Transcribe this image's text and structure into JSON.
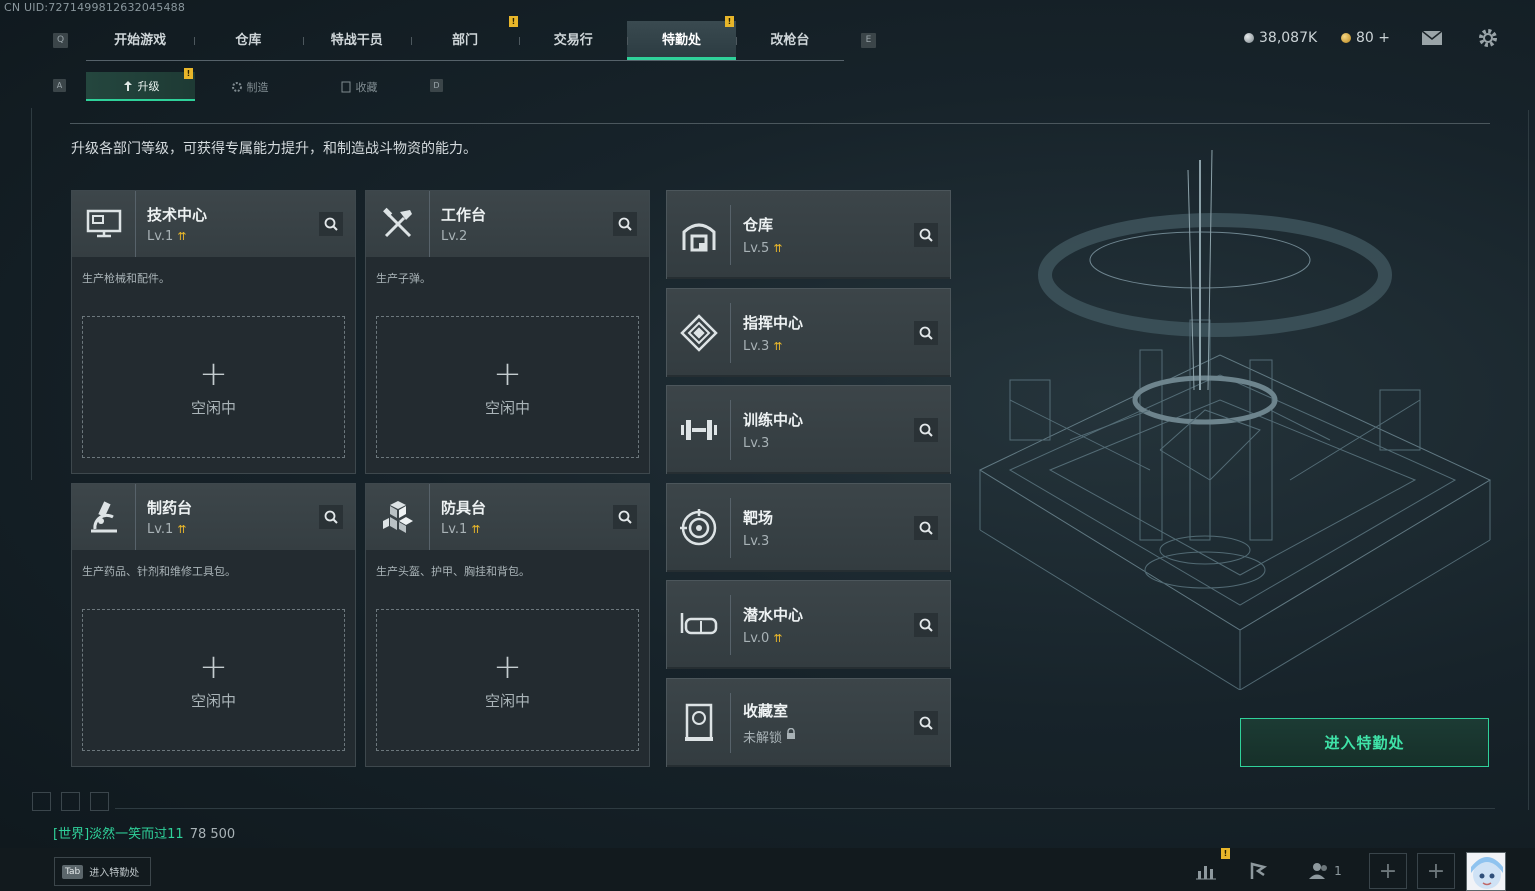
{
  "uid": "CN UID:7271499812632045488",
  "topnav": {
    "left_key": "Q",
    "right_key": "E",
    "tabs": [
      {
        "label": "开始游戏"
      },
      {
        "label": "仓库"
      },
      {
        "label": "特战干员"
      },
      {
        "label": "部门"
      },
      {
        "label": "交易行"
      },
      {
        "label": "特勤处"
      },
      {
        "label": "改枪台"
      }
    ],
    "active": "特勤处",
    "badge": "!"
  },
  "subnav": {
    "left_key": "A",
    "right_key": "D",
    "tabs": [
      {
        "label": "升级"
      },
      {
        "label": "制造"
      },
      {
        "label": "收藏"
      }
    ]
  },
  "currency": {
    "coins": "38,087K",
    "bonds": "80 +"
  },
  "intro": "升级各部门等级，可获得专属能力提升，和制造战斗物资的能力。",
  "stations": [
    {
      "name": "技术中心",
      "level": "Lv.1",
      "desc": "生产枪械和配件。",
      "slot_status": "空闲中",
      "icon": "monitor-icon"
    },
    {
      "name": "工作台",
      "level": "Lv.2",
      "desc": "生产子弹。",
      "slot_status": "空闲中",
      "icon": "tools-icon"
    },
    {
      "name": "制药台",
      "level": "Lv.1",
      "desc": "生产药品、针剂和维修工具包。",
      "slot_status": "空闲中",
      "icon": "microscope-icon"
    },
    {
      "name": "防具台",
      "level": "Lv.1",
      "desc": "生产头盔、护甲、胸挂和背包。",
      "slot_status": "空闲中",
      "icon": "cubes-icon"
    }
  ],
  "facilities": [
    {
      "name": "仓库",
      "level": "Lv.5",
      "icon": "warehouse-icon"
    },
    {
      "name": "指挥中心",
      "level": "Lv.3",
      "icon": "command-icon"
    },
    {
      "name": "训练中心",
      "level": "Lv.3",
      "icon": "dumbbell-icon"
    },
    {
      "name": "靶场",
      "level": "Lv.3",
      "icon": "target-icon"
    },
    {
      "name": "潜水中心",
      "level": "Lv.0",
      "icon": "diving-mask-icon"
    },
    {
      "name": "收藏室",
      "level": "未解锁",
      "icon": "collection-icon"
    }
  ],
  "enter_button": "进入特勤处",
  "chat": {
    "channel": "[世界]",
    "user": "淡然一笑而过11",
    "message": "78 500"
  },
  "bottom": {
    "tab_key": "Tab",
    "tab_label": "进入特勤处",
    "friends_count": "1"
  },
  "colors": {
    "accent": "#2fd19a",
    "badge": "#e8b62a",
    "panel": "#3b4448"
  }
}
